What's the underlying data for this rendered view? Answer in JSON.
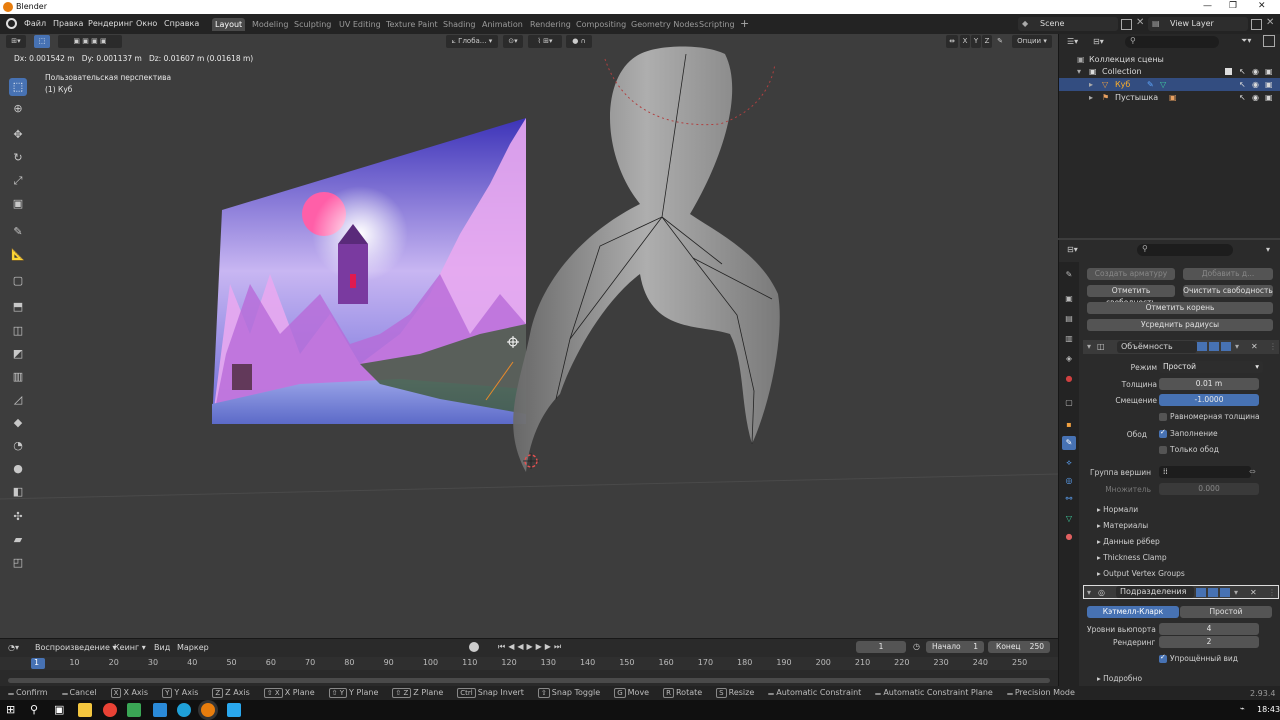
{
  "window": {
    "title": "Blender",
    "controls": [
      "—",
      "❐",
      "✕"
    ]
  },
  "menu": [
    "Файл",
    "Правка",
    "Рендеринг",
    "Окно",
    "Справка"
  ],
  "workspaces": [
    "Layout",
    "Modeling",
    "Sculpting",
    "UV Editing",
    "Texture Paint",
    "Shading",
    "Animation",
    "Rendering",
    "Compositing",
    "Geometry Nodes",
    "Scripting"
  ],
  "scene": {
    "name": "Scene",
    "view_layer": "View Layer"
  },
  "viewport": {
    "orientation": "Глоба...",
    "options_label": "Опции",
    "axes": [
      "X",
      "Y",
      "Z"
    ],
    "transform_readout": "Dx: 0.001542 m   Dy: 0.001137 m   Dz: 0.01607 m (0.01618 m)",
    "view_name": "Пользовательская перспектива",
    "object_label": "(1) Куб"
  },
  "outliner": {
    "title": "Коллекция сцены",
    "collection": "Collection",
    "items": [
      "Куб",
      "Пустышка"
    ]
  },
  "properties": {
    "buttons": {
      "create_armature": "Создать арматуру",
      "add": "Добавить д...",
      "mark_loose": "Отметить свободность",
      "clear_loose": "Очистить свободность",
      "mark_root": "Отметить корень",
      "equalize_radii": "Усреднить радиусы"
    },
    "solidify": {
      "name": "Объёмность",
      "mode_label": "Режим",
      "mode_value": "Простой",
      "thickness_label": "Толщина",
      "thickness_value": "0.01 m",
      "offset_label": "Смещение",
      "offset_value": "-1.0000",
      "even_thickness": "Равномерная толщина",
      "rim_label": "Обод",
      "fill": "Заполнение",
      "only_rim": "Только обод",
      "vertex_group_label": "Группа вершин",
      "factor_label": "Множитель",
      "factor_value": "0.000",
      "subpanels": [
        "Нормали",
        "Материалы",
        "Данные рёбер",
        "Thickness Clamp",
        "Output Vertex Groups"
      ]
    },
    "subdivision": {
      "name": "Подразделения",
      "tab_catmull": "Кэтмелл-Кларк",
      "tab_simple": "Простой",
      "levels_viewport_label": "Уровни вьюпорта",
      "levels_viewport_value": "4",
      "render_label": "Рендеринг",
      "render_value": "2",
      "optimal_display": "Упрощённый вид",
      "advanced": "Подробно"
    }
  },
  "timeline": {
    "playback": "Воспроизведение",
    "keying": "Кеинг",
    "view": "Вид",
    "marker": "Маркер",
    "current_frame": "1",
    "start_label": "Начало",
    "start_value": "1",
    "end_label": "Конец",
    "end_value": "250",
    "ruler": [
      "1",
      "10",
      "20",
      "30",
      "40",
      "50",
      "60",
      "70",
      "80",
      "90",
      "100",
      "110",
      "120",
      "130",
      "140",
      "150",
      "160",
      "170",
      "180",
      "190",
      "200",
      "210",
      "220",
      "230",
      "240",
      "250"
    ]
  },
  "statusbar": {
    "items": [
      {
        "key": "",
        "label": "Confirm"
      },
      {
        "key": "",
        "label": "Cancel"
      },
      {
        "key": "X",
        "label": "X Axis"
      },
      {
        "key": "Y",
        "label": "Y Axis"
      },
      {
        "key": "Z",
        "label": "Z Axis"
      },
      {
        "key": "⇧ X",
        "label": "X Plane"
      },
      {
        "key": "⇧ Y",
        "label": "Y Plane"
      },
      {
        "key": "⇧ Z",
        "label": "Z Plane"
      },
      {
        "key": "Ctrl",
        "label": "Snap Invert"
      },
      {
        "key": "⇧",
        "label": "Snap Toggle"
      },
      {
        "key": "G",
        "label": "Move"
      },
      {
        "key": "R",
        "label": "Rotate"
      },
      {
        "key": "S",
        "label": "Resize"
      },
      {
        "key": "",
        "label": "Automatic Constraint"
      },
      {
        "key": "",
        "label": "Automatic Constraint Plane"
      },
      {
        "key": "",
        "label": "Precision Mode"
      }
    ],
    "version": "2.93.4"
  },
  "taskbar": {
    "clock": "18:43"
  }
}
